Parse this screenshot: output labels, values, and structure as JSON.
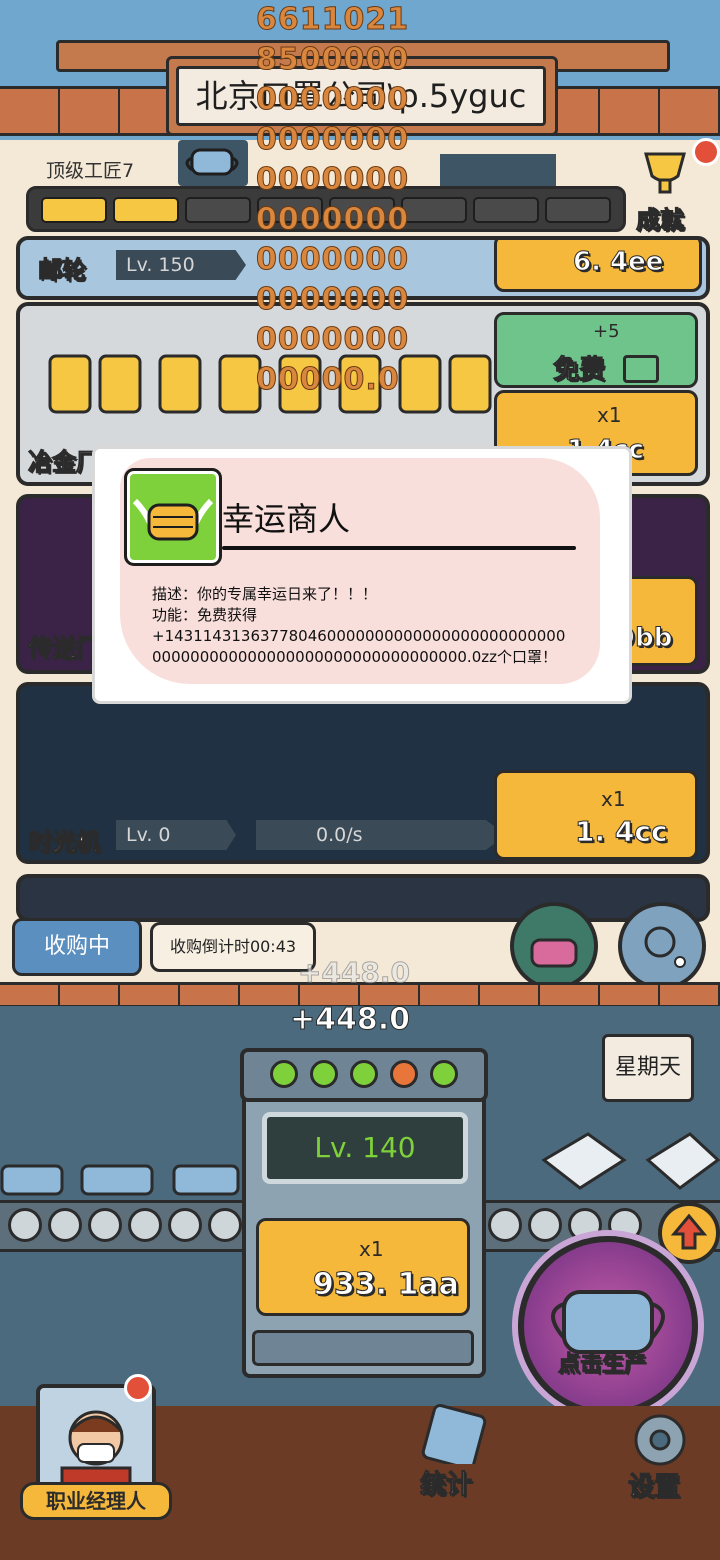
{
  "header": {
    "sign_text": "北京口罩公司\\p.5yguc",
    "rank": "顶级工匠7",
    "achievement_label": "成就",
    "overflow_number": "66110218500000000000000000000000000000000000000000000000000000000000.0",
    "progress_segments": [
      "#f5c742",
      "#f5c742",
      "#4a4a4a",
      "#4a4a4a",
      "#4a4a4a",
      "#4a4a4a",
      "#4a4a4a",
      "#4a4a4a"
    ]
  },
  "rows": {
    "ship": {
      "name": "邮轮",
      "level": "Lv. 150",
      "price": "6. 4ee"
    },
    "smelter": {
      "name": "冶金厂",
      "free_bonus": "+5",
      "free_label": "免费",
      "multiplier": "x1",
      "price": "1.4cc"
    },
    "teleport": {
      "name": "传送门",
      "price": "9bb"
    },
    "timemachine": {
      "name": "时光机",
      "level": "Lv. 0",
      "rate": "0.0/s",
      "multiplier": "x1",
      "price": "1. 4cc"
    }
  },
  "dialog": {
    "title": "幸运商人",
    "desc_line1": "描述：你的专属幸运日来了！！！",
    "desc_line2": "功能：免费获得",
    "desc_line3": "+143114313637780460000000000000000000000000000000000000000000000000000000000.0zz个口罩！"
  },
  "bottom": {
    "buying": "收购中",
    "countdown": "收购倒计时00:43",
    "float_gain_faded": "+448.0",
    "float_gain": "+448.0",
    "machine_level": "Lv. 140",
    "machine_multiplier": "x1",
    "machine_price": "933. 1aa",
    "weekday": "星期天",
    "produce_label": "点击生产",
    "manager_label": "职业经理人",
    "stats_label": "统计",
    "settings_label": "设置"
  },
  "colors": {
    "accent_yellow": "#f5b83a",
    "accent_green": "#6fc48c",
    "dialog_bg": "#f8dfdb",
    "icon_green": "#7ed13a"
  }
}
